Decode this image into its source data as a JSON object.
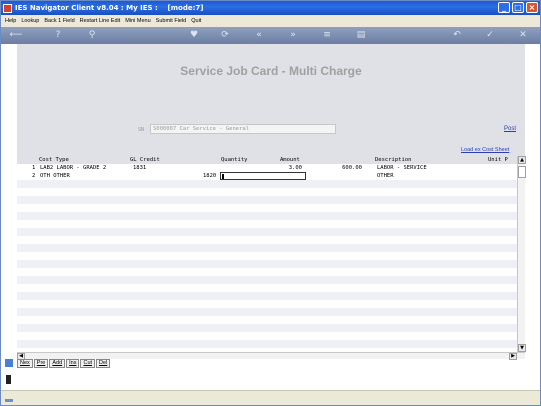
{
  "window": {
    "title": "IES Navigator Client v8.04 : My IES :    [mode:7]",
    "buttons": [
      "_",
      "□",
      "×"
    ]
  },
  "menu": [
    "Help",
    "Lookup",
    "Back 1 Field",
    "Restart Line Edit",
    "Mini Menu",
    "Submit Field",
    "Quit"
  ],
  "toolbar": {
    "icons": [
      "back-arrow-icon",
      "help-icon",
      "search-icon",
      "favorite-heart-icon",
      "refresh-icon",
      "rewind-icon",
      "fast-forward-icon",
      "menu-icon",
      "document-icon",
      "return-icon",
      "check-icon",
      "close-icon"
    ],
    "glyphs": [
      "⟵",
      "?",
      "⚲",
      "♥",
      "⟳",
      "«",
      "»",
      "≡",
      "▤",
      "↶",
      "✓",
      "✕"
    ]
  },
  "page": {
    "title": "Service Job Card - Multi Charge",
    "job_label": "SN",
    "job_value": "S000007 Car Service - General",
    "post_link": "Post",
    "load_link": "Load ex Cost Sheet"
  },
  "grid": {
    "columns": [
      "Cost Type",
      "GL Credit",
      "Quantity",
      "Amount",
      "Description",
      "Unit P"
    ],
    "rows": [
      {
        "num": "1",
        "cost_type": "LAB2 LABOR - GRADE 2",
        "gl_credit": "1831",
        "quantity": "3.00",
        "amount": "600.00",
        "description": "LABOR - SERVICE"
      },
      {
        "num": "2",
        "cost_type": "OTH OTHER",
        "gl_credit": "1820",
        "quantity": "",
        "amount": "",
        "description": "OTHER"
      }
    ]
  },
  "bottom_buttons": [
    "Nex",
    "Pre",
    "Add",
    "Ins",
    "Cut",
    "Del"
  ],
  "colors": {
    "title_bar": "#1d5ad1",
    "toolbar": "#7b8db2",
    "header_panel": "#dfe1e7",
    "link": "#2a3fb0"
  }
}
